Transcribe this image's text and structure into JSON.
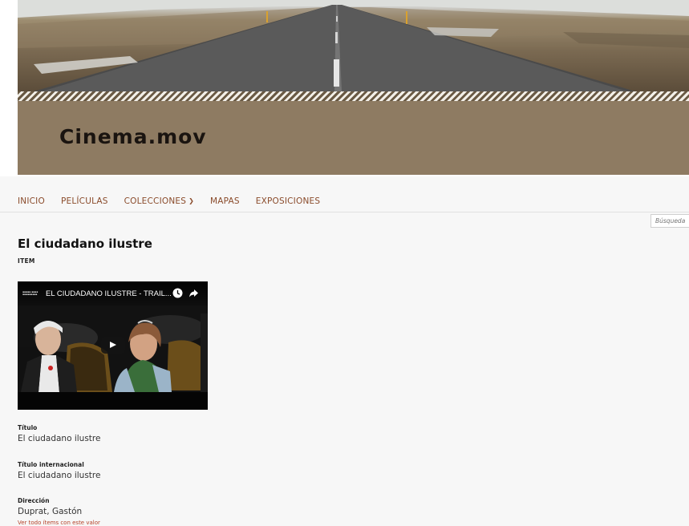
{
  "site": {
    "title": "Cinema.mov"
  },
  "nav": {
    "items": [
      {
        "label": "INICIO"
      },
      {
        "label": "PELÍCULAS"
      },
      {
        "label": "COLECCIONES"
      },
      {
        "label": "MAPAS"
      },
      {
        "label": "EXPOSICIONES"
      }
    ]
  },
  "search": {
    "placeholder": "Búsqueda"
  },
  "item": {
    "title": "El ciudadano ilustre",
    "type": "ITEM",
    "video": {
      "title": "EL CIUDADANO ILUSTRE - TRAIL..."
    },
    "metadata": [
      {
        "label": "Título",
        "value": "El ciudadano ilustre"
      },
      {
        "label": "Título internacional",
        "value": "El ciudadano ilustre"
      },
      {
        "label": "Dirección",
        "value": "Duprat, Gastón",
        "link": "Ver todo ítems con este valor"
      }
    ]
  },
  "colors": {
    "accent": "#8a4b2b",
    "band": "#8e7b62",
    "link": "#b5432a"
  }
}
